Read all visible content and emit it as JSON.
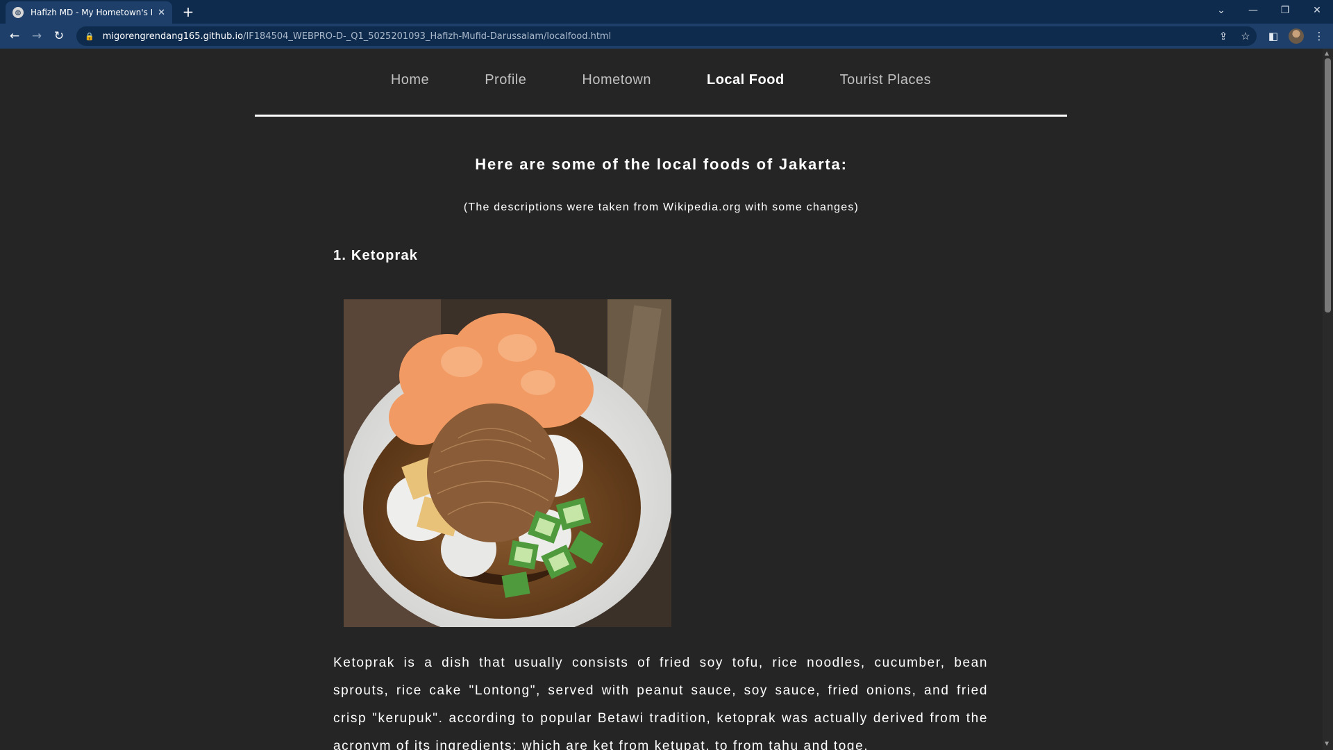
{
  "browser": {
    "tab_title": "Hafizh MD - My Hometown's Loc",
    "tab_close_icon": "close-icon",
    "new_tab_label": "+",
    "url_host": "migorengrendang165.github.io",
    "url_path": "/IF184504_WEBPRO-D-_Q1_5025201093_Hafizh-Mufid-Darussalam/localfood.html",
    "window_controls": [
      "chevron-down-icon",
      "minimize-icon",
      "restore-icon",
      "close-icon"
    ]
  },
  "nav": {
    "items": [
      {
        "label": "Home",
        "active": false
      },
      {
        "label": "Profile",
        "active": false
      },
      {
        "label": "Hometown",
        "active": false
      },
      {
        "label": "Local Food",
        "active": true
      },
      {
        "label": "Tourist Places",
        "active": false
      }
    ]
  },
  "content": {
    "heading": "Here are some of the local foods of Jakarta:",
    "subheading": "(The descriptions were taken from Wikipedia.org with some changes)",
    "foods": [
      {
        "title": "1. Ketoprak",
        "description": "Ketoprak is a dish that usually consists of fried soy tofu, rice noodles, cucumber, bean sprouts, rice cake \"Lontong\", served with peanut sauce, soy sauce, fried onions, and fried crisp \"kerupuk\". according to popular Betawi tradition, ketoprak was actually derived from the acronym of its ingredients: which are ket from ketupat, to from tahu and toge."
      }
    ]
  },
  "colors": {
    "page_bg": "#252525",
    "browser_frame": "#0e2a4d",
    "browser_toolbar": "#1d3f6a",
    "text": "#ffffff",
    "nav_inactive": "#c0c0c0"
  }
}
